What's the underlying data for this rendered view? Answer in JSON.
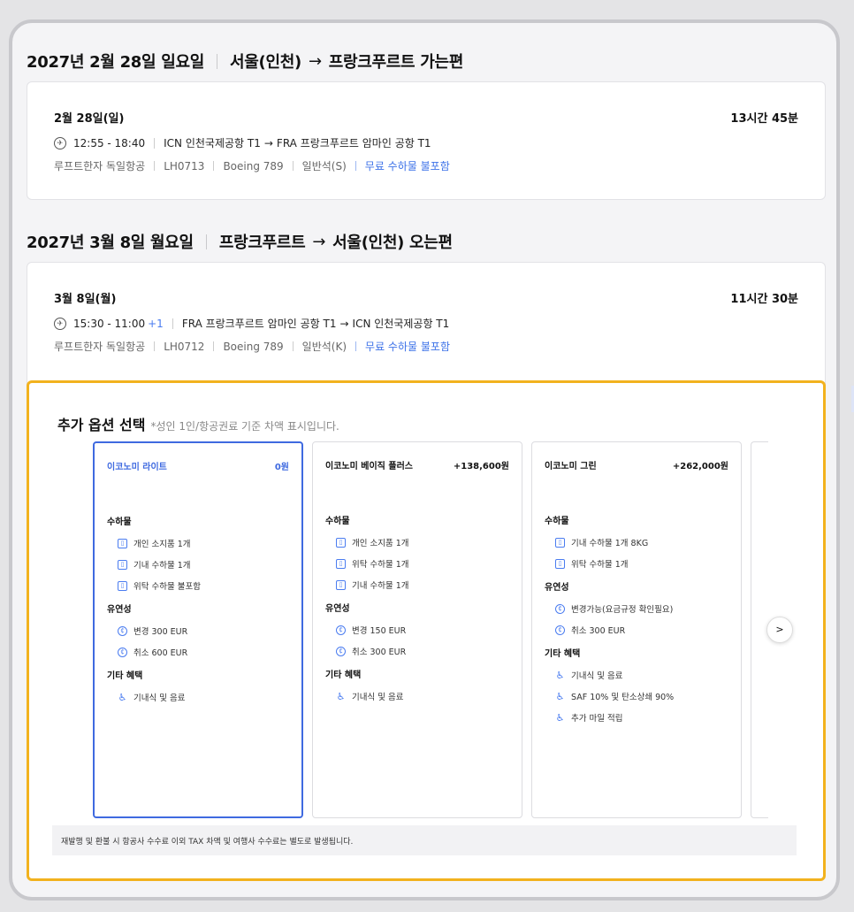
{
  "outbound": {
    "heading_date": "2027년 2월 28일 일요일",
    "heading_from": "서울(인천)",
    "arrow": "→",
    "heading_to": "프랑크푸르트 가는편",
    "day": "2월 28일(일)",
    "duration": "13시간 45분",
    "times": "12:55 - 18:40",
    "plus_day": "",
    "route_from": "ICN 인천국제공항 T1",
    "route_to": "FRA 프랑크푸르트 암마인 공항 T1",
    "airline": "루프트한자 독일항공",
    "flight_no": "LH0713",
    "aircraft": "Boeing 789",
    "cabin": "일반석(S)",
    "baggage": "무료 수하물 불포함"
  },
  "inbound": {
    "heading_date": "2027년 3월 8일 월요일",
    "heading_from": "프랑크푸르트",
    "arrow": "→",
    "heading_to": "서울(인천) 오는편",
    "day": "3월 8일(월)",
    "duration": "11시간 30분",
    "times": "15:30 - 11:00",
    "plus_day": "+1",
    "route_from": "FRA 프랑크푸르트 암마인 공항 T1",
    "route_to": "ICN 인천국제공항 T1",
    "airline": "루프트한자 독일항공",
    "flight_no": "LH0712",
    "aircraft": "Boeing 789",
    "cabin": "일반석(K)",
    "baggage": "무료 수하물 불포함"
  },
  "options": {
    "title": "추가 옵션 선택",
    "note": "*성인 1인/항공권료 기준 차액 표시입니다.",
    "labels": {
      "baggage": "수하물",
      "flex": "유연성",
      "benefits": "기타 혜택"
    },
    "fares": [
      {
        "name": "이코노미 라이트",
        "price": "0원",
        "selected": true,
        "baggage": [
          "개인 소지품 1개",
          "기내 수하물 1개",
          "위탁 수하물 불포함"
        ],
        "flex": [
          "변경 300 EUR",
          "취소 600 EUR"
        ],
        "benefits": [
          "기내식 및 음료"
        ]
      },
      {
        "name": "이코노미 베이직 플러스",
        "price": "+138,600원",
        "selected": false,
        "baggage": [
          "개인 소지품 1개",
          "위탁 수하물 1개",
          "기내 수하물 1개"
        ],
        "flex": [
          "변경 150 EUR",
          "취소 300 EUR"
        ],
        "benefits": [
          "기내식 및 음료"
        ]
      },
      {
        "name": "이코노미 그린",
        "price": "+262,000원",
        "selected": false,
        "baggage": [
          "기내 수하물 1개 8KG",
          "위탁 수하물 1개"
        ],
        "flex": [
          "변경가능(요금규정 확인필요)",
          "취소 300 EUR"
        ],
        "benefits": [
          "기내식 및 음료",
          "SAF 10% 및 탄소상쇄 90%",
          "추가 마일 적립"
        ]
      }
    ],
    "next_label": ">",
    "footer_notice": "재발행 및 환불 시 항공사 수수료 이외 TAX 차액 및 여행사 수수료는 별도로 발생됩니다."
  },
  "icons": {
    "plane": "plane-icon",
    "baggage": "luggage-icon",
    "flex": "coin-icon",
    "benefit": "seat-icon"
  },
  "colors": {
    "accent": "#3f6ae0",
    "highlight_border": "#f2b21e",
    "link": "#3d72e8"
  }
}
